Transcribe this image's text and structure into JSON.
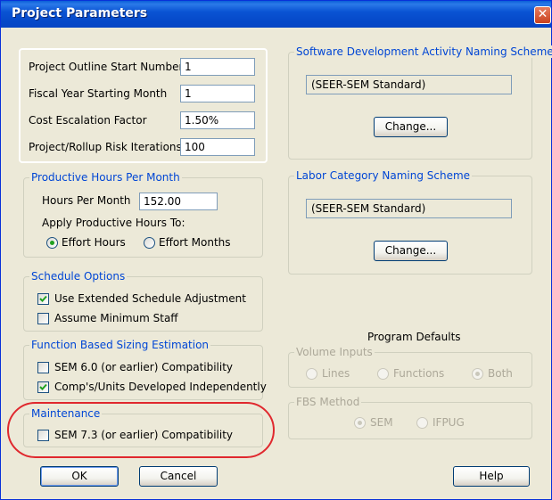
{
  "window": {
    "title": "Project Parameters",
    "close_glyph": "✕"
  },
  "project": {
    "outline_start_label": "Project Outline Start Number",
    "outline_start_value": "1",
    "fiscal_year_label": "Fiscal Year Starting Month",
    "fiscal_year_value": "1",
    "cost_escalation_label": "Cost Escalation Factor",
    "cost_escalation_value": "1.50%",
    "risk_iterations_label": "Project/Rollup Risk Iterations",
    "risk_iterations_value": "100"
  },
  "productive_hours": {
    "legend": "Productive Hours Per Month",
    "hours_label": "Hours Per Month",
    "hours_value": "152.00",
    "apply_label": "Apply Productive Hours To:",
    "effort_hours": "Effort Hours",
    "effort_months": "Effort Months",
    "selected": "Effort Hours"
  },
  "schedule": {
    "legend": "Schedule Options",
    "extended_label": "Use Extended Schedule Adjustment",
    "extended_checked": true,
    "min_staff_label": "Assume Minimum Staff",
    "min_staff_checked": false
  },
  "fbs": {
    "legend": "Function Based Sizing Estimation",
    "sem6_label": "SEM 6.0 (or earlier) Compatibility",
    "sem6_checked": false,
    "comps_label": "Comp's/Units Developed Independently",
    "comps_checked": true
  },
  "maintenance": {
    "legend": "Maintenance",
    "sem73_label": "SEM 7.3 (or earlier) Compatibility",
    "sem73_checked": false
  },
  "software_naming": {
    "legend": "Software Development Activity Naming Scheme",
    "value": "(SEER-SEM Standard)",
    "change_label": "Change..."
  },
  "labor_naming": {
    "legend": "Labor Category Naming Scheme",
    "value": "(SEER-SEM Standard)",
    "change_label": "Change..."
  },
  "program_defaults": {
    "title": "Program Defaults",
    "volume_legend": "Volume Inputs",
    "lines": "Lines",
    "functions": "Functions",
    "both": "Both",
    "volume_selected": "Both",
    "fbs_method_legend": "FBS Method",
    "sem": "SEM",
    "ifpug": "IFPUG",
    "fbs_selected": "SEM"
  },
  "buttons": {
    "ok": "OK",
    "cancel": "Cancel",
    "help": "Help"
  },
  "colors": {
    "accent": "#0046d5",
    "highlight_ring": "#e0282e",
    "check_mark": "#21a121"
  }
}
